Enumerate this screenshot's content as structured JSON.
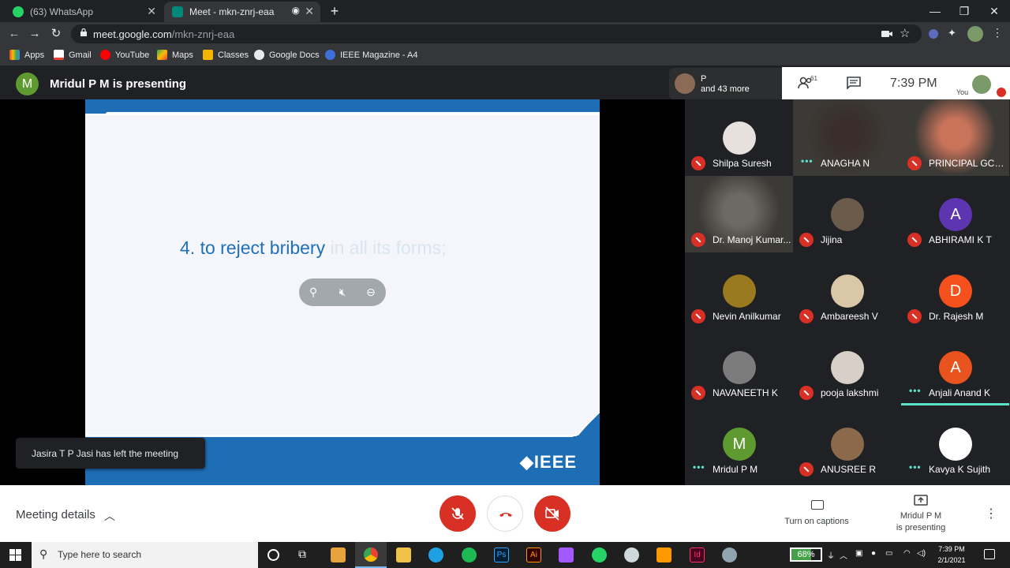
{
  "browser": {
    "tabs": [
      {
        "label": "(63) WhatsApp",
        "active": false
      },
      {
        "label": "Meet - mkn-znrj-eaa",
        "active": true
      }
    ],
    "url_host": "meet.google.com",
    "url_path": "/mkn-znrj-eaa",
    "bookmarks": [
      "Apps",
      "Gmail",
      "YouTube",
      "Maps",
      "Classes",
      "Google Docs",
      "IEEE Magazine - A4"
    ]
  },
  "meet": {
    "presenter_initial": "M",
    "presenter_title": "Mridul P M is presenting",
    "others_line1": "P",
    "others_line2": "and 43 more",
    "participant_count": "61",
    "time": "7:39 PM",
    "you_label": "You",
    "slide_text_main": "4. to reject bribery",
    "slide_text_dim": " in all its forms;",
    "slide_brand": "◆IEEE",
    "toast": "Jasira T P Jasi has left the meeting",
    "participants": [
      {
        "name": "Shilpa Suresh",
        "initial": "",
        "color": "#e8e0dc",
        "status": "muted",
        "video": false
      },
      {
        "name": "ANAGHA N",
        "initial": "",
        "color": "#3a2e2a",
        "status": "talking",
        "video": true
      },
      {
        "name": "PRINCIPAL GCE ...",
        "initial": "",
        "color": "#c8735a",
        "status": "muted",
        "video": true
      },
      {
        "name": "Dr. Manoj Kumar...",
        "initial": "",
        "color": "#6d6a63",
        "status": "muted",
        "video": true
      },
      {
        "name": "Jijina",
        "initial": "",
        "color": "#6b5b4a",
        "status": "muted",
        "video": false
      },
      {
        "name": "ABHIRAMI K T",
        "initial": "A",
        "color": "#5e35b1",
        "status": "muted",
        "video": false
      },
      {
        "name": "Nevin Anilkumar",
        "initial": "",
        "color": "#9a7a1f",
        "status": "muted",
        "video": false
      },
      {
        "name": "Ambareesh V",
        "initial": "",
        "color": "#d9c7a8",
        "status": "muted",
        "video": false
      },
      {
        "name": "Dr. Rajesh M",
        "initial": "D",
        "color": "#f4511e",
        "status": "muted",
        "video": false
      },
      {
        "name": "NAVANEETH K",
        "initial": "",
        "color": "#7c7c7c",
        "status": "muted",
        "video": false
      },
      {
        "name": "pooja lakshmi",
        "initial": "",
        "color": "#d8cfc8",
        "status": "muted",
        "video": false
      },
      {
        "name": "Anjali Anand K",
        "initial": "A",
        "color": "#e8531e",
        "status": "talking",
        "video": false
      },
      {
        "name": "Mridul P M",
        "initial": "M",
        "color": "#5f9a31",
        "status": "talking",
        "video": false
      },
      {
        "name": "ANUSREE R",
        "initial": "",
        "color": "#8a6a4a",
        "status": "muted",
        "video": false
      },
      {
        "name": "Kavya K Sujith",
        "initial": "",
        "color": "#ffffff",
        "status": "talking",
        "video": false
      }
    ],
    "meeting_details": "Meeting details",
    "captions_label": "Turn on captions",
    "presenting_line1": "Mridul P M",
    "presenting_line2": "is presenting"
  },
  "taskbar": {
    "search_placeholder": "Type here to search",
    "battery": "68%",
    "clock_time": "7:39 PM",
    "clock_date": "2/1/2021"
  }
}
